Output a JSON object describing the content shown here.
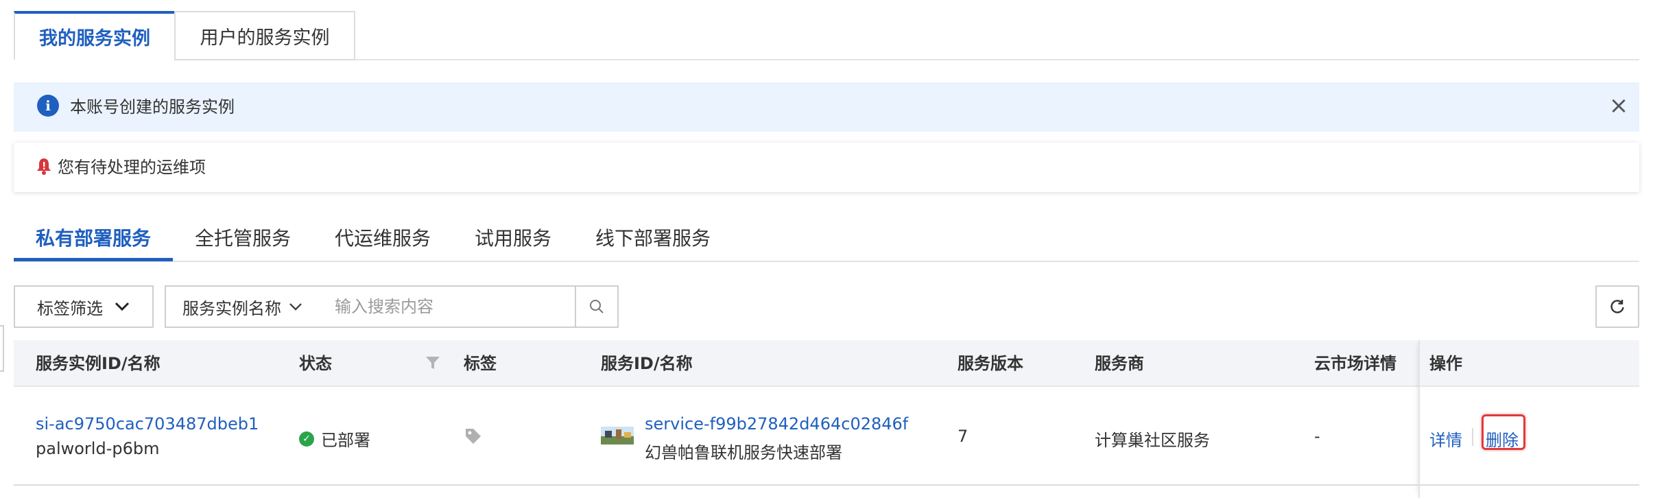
{
  "top_tabs": [
    "我的服务实例",
    "用户的服务实例"
  ],
  "info_banner": {
    "text": "本账号创建的服务实例"
  },
  "pending_banner": {
    "text": "您有待处理的运维项"
  },
  "service_tabs": [
    "私有部署服务",
    "全托管服务",
    "代运维服务",
    "试用服务",
    "线下部署服务"
  ],
  "toolbar": {
    "tag_filter_label": "标签筛选",
    "search_field_label": "服务实例名称",
    "search_placeholder": "输入搜索内容"
  },
  "table": {
    "columns": [
      "服务实例ID/名称",
      "状态",
      "标签",
      "服务ID/名称",
      "服务版本",
      "服务商",
      "云市场详情",
      "操作"
    ],
    "rows": [
      {
        "instance_id": "si-ac9750cac703487dbeb1",
        "instance_name": "palworld-p6bm",
        "status": "已部署",
        "service_id": "service-f99b27842d464c02846f",
        "service_name": "幻兽帕鲁联机服务快速部署",
        "version": "7",
        "provider": "计算巢社区服务",
        "market_detail": "-",
        "actions": [
          "详情",
          "删除"
        ]
      }
    ]
  },
  "colors": {
    "accent": "#1f5fbf",
    "success": "#2ba34a",
    "highlight": "#e03a3a",
    "info_bg": "#eaf3fe"
  }
}
